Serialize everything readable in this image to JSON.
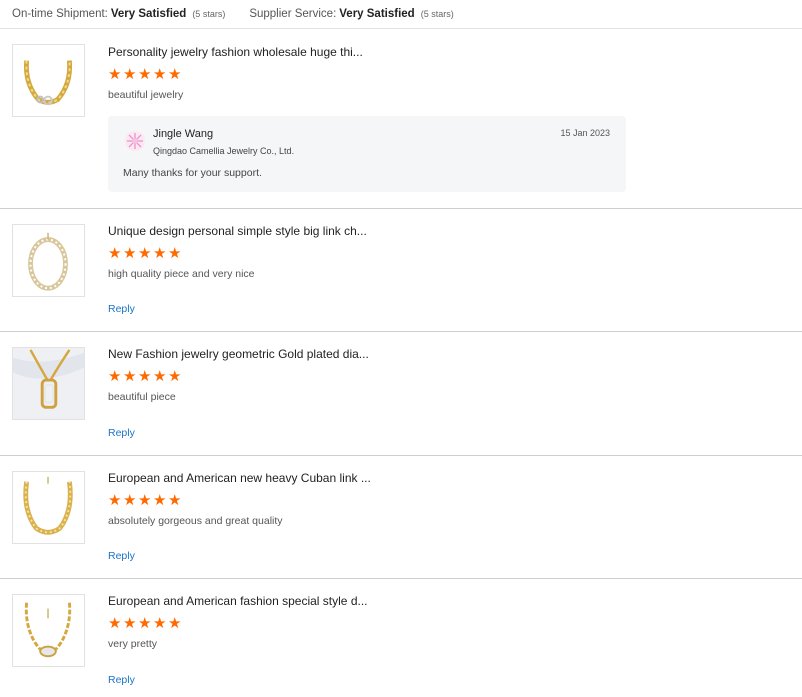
{
  "ratings": {
    "shipment": {
      "label": "On-time Shipment:",
      "value": "Very Satisfied",
      "stars": "(5 stars)"
    },
    "service": {
      "label": "Supplier Service:",
      "value": "Very Satisfied",
      "stars": "(5 stars)"
    }
  },
  "reviews": [
    {
      "product_title": "Personality jewelry fashion wholesale huge thi...",
      "rating": 5,
      "comment": "beautiful jewelry",
      "supplier_reply": {
        "name": "Jingle Wang",
        "company": "Qingdao Camellia Jewelry Co., Ltd.",
        "date": "15 Jan 2023",
        "text": "Many thanks for your support."
      }
    },
    {
      "product_title": "Unique design personal simple style big link ch...",
      "rating": 5,
      "comment": "high quality piece and very nice",
      "reply_label": "Reply"
    },
    {
      "product_title": "New Fashion jewelry geometric Gold plated dia...",
      "rating": 5,
      "comment": "beautiful piece",
      "reply_label": "Reply"
    },
    {
      "product_title": "European and American new heavy Cuban link ...",
      "rating": 5,
      "comment": "absolutely gorgeous and great quality",
      "reply_label": "Reply"
    },
    {
      "product_title": "European and American fashion special style d...",
      "rating": 5,
      "comment": "very pretty",
      "reply_label": "Reply"
    }
  ],
  "colors": {
    "star": "#ff6a00",
    "link": "#1a73c8",
    "reply_bg": "#f5f6f8"
  }
}
